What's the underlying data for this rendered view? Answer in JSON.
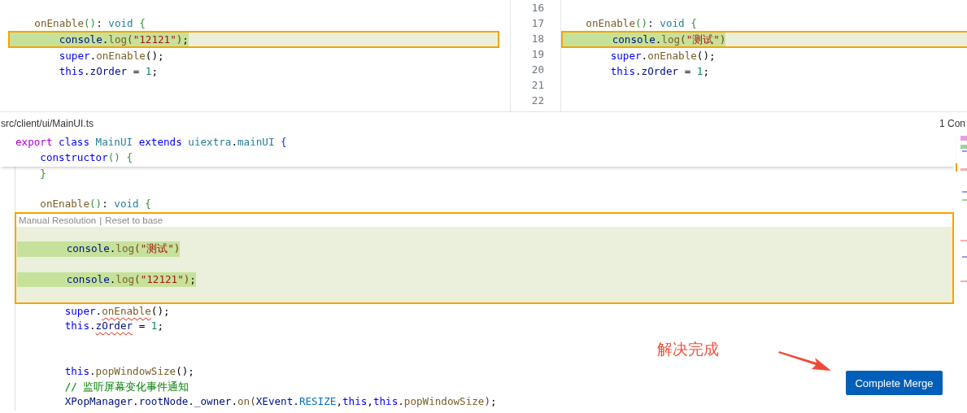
{
  "incoming_pane": {
    "segments": [
      {
        "kind": "plain",
        "lines": [
          {
            "kind": "blank"
          },
          {
            "kind": "code",
            "tokens": [
              {
                "text": "    onEnable",
                "kind": "fn"
              },
              {
                "text": "()",
                "kind": "b2"
              },
              {
                "text": ": ",
                "kind": "punct"
              },
              {
                "text": "void",
                "kind": "type"
              },
              {
                "text": " {",
                "kind": "b2"
              }
            ]
          }
        ]
      },
      {
        "kind": "conflict",
        "lines": [
          {
            "kind": "code",
            "tokens": [
              {
                "text": "        console",
                "kind": "var"
              },
              {
                "text": ".",
                "kind": "punct"
              },
              {
                "text": "log",
                "kind": "fn"
              },
              {
                "text": "(",
                "kind": "b3"
              },
              {
                "text": "\"12121\"",
                "kind": "str"
              },
              {
                "text": ")",
                "kind": "b3"
              },
              {
                "text": ";",
                "kind": "punct"
              }
            ]
          }
        ]
      },
      {
        "kind": "plain",
        "lines": [
          {
            "kind": "code",
            "tokens": [
              {
                "text": "        super",
                "kind": "kw"
              },
              {
                "text": ".",
                "kind": "punct"
              },
              {
                "text": "onEnable",
                "kind": "fn"
              },
              {
                "text": "();",
                "kind": "punct"
              }
            ]
          },
          {
            "kind": "code",
            "tokens": [
              {
                "text": "        this",
                "kind": "kw"
              },
              {
                "text": ".",
                "kind": "punct"
              },
              {
                "text": "zOrder",
                "kind": "var"
              },
              {
                "text": " = ",
                "kind": "punct"
              },
              {
                "text": "1",
                "kind": "num"
              },
              {
                "text": ";",
                "kind": "punct"
              }
            ]
          },
          {
            "kind": "blank"
          },
          {
            "kind": "blank"
          }
        ]
      }
    ]
  },
  "current_pane": {
    "line_numbers": [
      "16",
      "17",
      "18",
      "19",
      "20",
      "21",
      "22"
    ],
    "segments": [
      {
        "kind": "plain",
        "lines": [
          {
            "kind": "blank"
          },
          {
            "kind": "code",
            "tokens": [
              {
                "text": "    onEnable",
                "kind": "fn"
              },
              {
                "text": "()",
                "kind": "b2"
              },
              {
                "text": ": ",
                "kind": "punct"
              },
              {
                "text": "void",
                "kind": "type"
              },
              {
                "text": " {",
                "kind": "b2"
              }
            ]
          }
        ]
      },
      {
        "kind": "conflict",
        "lines": [
          {
            "kind": "code",
            "tokens": [
              {
                "text": "        console",
                "kind": "var"
              },
              {
                "text": ".",
                "kind": "punct"
              },
              {
                "text": "log",
                "kind": "fn"
              },
              {
                "text": "(",
                "kind": "b3"
              },
              {
                "text": "\"测试\"",
                "kind": "str"
              },
              {
                "text": ")",
                "kind": "b3"
              }
            ]
          }
        ]
      },
      {
        "kind": "plain",
        "lines": [
          {
            "kind": "code",
            "tokens": [
              {
                "text": "        super",
                "kind": "kw"
              },
              {
                "text": ".",
                "kind": "punct"
              },
              {
                "text": "onEnable",
                "kind": "fn"
              },
              {
                "text": "();",
                "kind": "punct"
              }
            ]
          },
          {
            "kind": "code",
            "tokens": [
              {
                "text": "        this",
                "kind": "kw"
              },
              {
                "text": ".",
                "kind": "punct"
              },
              {
                "text": "zOrder",
                "kind": "var"
              },
              {
                "text": " = ",
                "kind": "punct"
              },
              {
                "text": "1",
                "kind": "num"
              },
              {
                "text": ";",
                "kind": "punct"
              }
            ]
          },
          {
            "kind": "blank"
          },
          {
            "kind": "blank"
          }
        ]
      }
    ]
  },
  "result_editor": {
    "file_path": "src/client/ui/MainUI.ts",
    "conflict_count": "1 Con",
    "sticky_lines": [
      {
        "kind": "code",
        "tokens": [
          {
            "text": "export",
            "kind": "ctrl"
          },
          {
            "text": " class ",
            "kind": "kw"
          },
          {
            "text": "MainUI",
            "kind": "type"
          },
          {
            "text": " extends ",
            "kind": "kw"
          },
          {
            "text": "uiextra",
            "kind": "type"
          },
          {
            "text": ".",
            "kind": "punct"
          },
          {
            "text": "mainUI",
            "kind": "type"
          },
          {
            "text": " {",
            "kind": "b1"
          }
        ]
      },
      {
        "kind": "code",
        "tokens": [
          {
            "text": "    constructor",
            "kind": "kw"
          },
          {
            "text": "()",
            "kind": "b2"
          },
          {
            "text": " {",
            "kind": "b2"
          }
        ]
      }
    ],
    "segments": [
      {
        "kind": "plain",
        "lines": [
          {
            "kind": "code",
            "tokens": [
              {
                "text": "    }",
                "kind": "b2"
              }
            ]
          },
          {
            "kind": "blank"
          },
          {
            "kind": "code",
            "tokens": [
              {
                "text": "    onEnable",
                "kind": "fn"
              },
              {
                "text": "()",
                "kind": "b2"
              },
              {
                "text": ": ",
                "kind": "punct"
              },
              {
                "text": "void",
                "kind": "type"
              },
              {
                "text": " {",
                "kind": "b2"
              }
            ]
          }
        ]
      },
      {
        "kind": "conflict",
        "actions": [
          "Manual Resolution",
          "Reset to base"
        ],
        "separator": "|",
        "lines": [
          {
            "kind": "blank"
          },
          {
            "kind": "code",
            "tokens": [
              {
                "text": "        console",
                "kind": "var"
              },
              {
                "text": ".",
                "kind": "punct"
              },
              {
                "text": "log",
                "kind": "fn"
              },
              {
                "text": "(",
                "kind": "b3"
              },
              {
                "text": "\"测试\"",
                "kind": "str"
              },
              {
                "text": ")",
                "kind": "b3"
              }
            ]
          },
          {
            "kind": "blank"
          },
          {
            "kind": "code",
            "tokens": [
              {
                "text": "        console",
                "kind": "var"
              },
              {
                "text": ".",
                "kind": "punct"
              },
              {
                "text": "log",
                "kind": "fn"
              },
              {
                "text": "(",
                "kind": "b3"
              },
              {
                "text": "\"12121\"",
                "kind": "str"
              },
              {
                "text": ")",
                "kind": "b3"
              },
              {
                "text": ";",
                "kind": "punct"
              }
            ]
          },
          {
            "kind": "blank"
          }
        ]
      },
      {
        "kind": "plain",
        "lines": [
          {
            "kind": "code",
            "tokens": [
              {
                "text": "        super",
                "kind": "kw"
              },
              {
                "text": ".",
                "kind": "punct"
              },
              {
                "text": "onEnable",
                "kind": "fn",
                "squiggle": true
              },
              {
                "text": "();",
                "kind": "punct"
              }
            ]
          },
          {
            "kind": "code",
            "tokens": [
              {
                "text": "        this",
                "kind": "kw"
              },
              {
                "text": ".",
                "kind": "punct"
              },
              {
                "text": "zOrder",
                "kind": "var",
                "squiggle": true
              },
              {
                "text": " = ",
                "kind": "punct"
              },
              {
                "text": "1",
                "kind": "num"
              },
              {
                "text": ";",
                "kind": "punct"
              }
            ]
          },
          {
            "kind": "blank"
          },
          {
            "kind": "blank"
          },
          {
            "kind": "code",
            "tokens": [
              {
                "text": "        this",
                "kind": "kw"
              },
              {
                "text": ".",
                "kind": "punct"
              },
              {
                "text": "popWindowSize",
                "kind": "fn"
              },
              {
                "text": "();",
                "kind": "punct"
              }
            ]
          },
          {
            "kind": "code",
            "tokens": [
              {
                "text": "        // 监听屏幕变化事件通知",
                "kind": "comment"
              }
            ]
          },
          {
            "kind": "code",
            "tokens": [
              {
                "text": "        XPopManager",
                "kind": "var"
              },
              {
                "text": ".",
                "kind": "punct"
              },
              {
                "text": "rootNode",
                "kind": "var"
              },
              {
                "text": ".",
                "kind": "punct"
              },
              {
                "text": "_owner",
                "kind": "var"
              },
              {
                "text": ".",
                "kind": "punct"
              },
              {
                "text": "on",
                "kind": "fn"
              },
              {
                "text": "(",
                "kind": "b3"
              },
              {
                "text": "XEvent",
                "kind": "var"
              },
              {
                "text": ".",
                "kind": "punct"
              },
              {
                "text": "RESIZE",
                "kind": "const"
              },
              {
                "text": ",",
                "kind": "punct"
              },
              {
                "text": "this",
                "kind": "kw"
              },
              {
                "text": ",",
                "kind": "punct"
              },
              {
                "text": "this",
                "kind": "kw"
              },
              {
                "text": ".",
                "kind": "punct"
              },
              {
                "text": "popWindowSize",
                "kind": "fn"
              },
              {
                "text": ")",
                "kind": "b3"
              },
              {
                "text": ";",
                "kind": "punct"
              }
            ]
          }
        ]
      }
    ]
  },
  "annotation": {
    "text": "解决完成"
  },
  "complete_button": {
    "label": "Complete Merge"
  }
}
